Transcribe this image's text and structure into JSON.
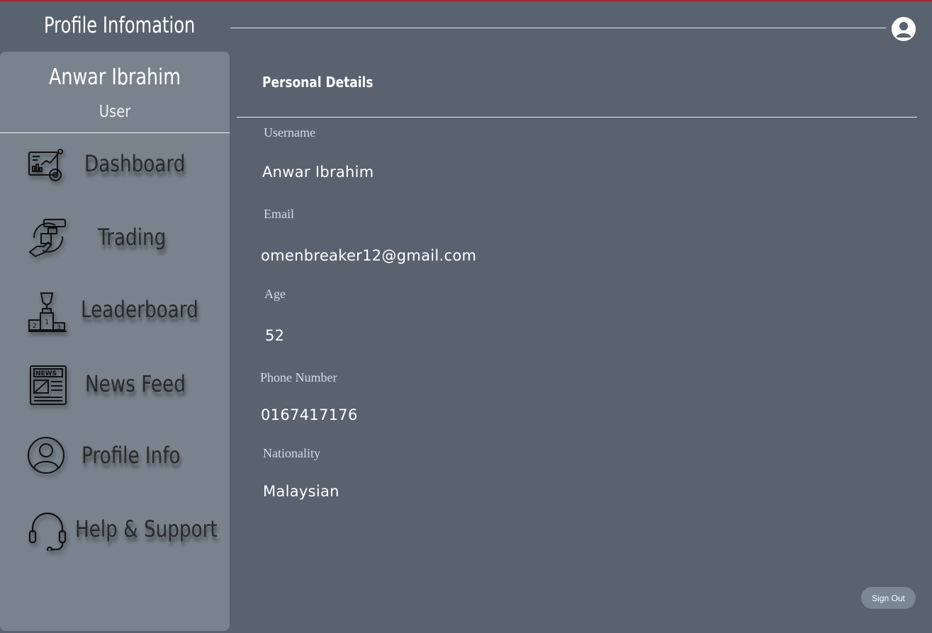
{
  "header": {
    "title": "Profile Infomation"
  },
  "sidebar": {
    "user_name": "Anwar Ibrahim",
    "user_role": "User",
    "items": [
      {
        "label": "Dashboard",
        "icon": "dashboard-icon"
      },
      {
        "label": "Trading",
        "icon": "trading-icon"
      },
      {
        "label": "Leaderboard",
        "icon": "podium-icon"
      },
      {
        "label": "News Feed",
        "icon": "newspaper-icon"
      },
      {
        "label": "Profile Info",
        "icon": "user-circle-icon"
      },
      {
        "label": "Help & Support",
        "icon": "headset-icon"
      }
    ]
  },
  "main": {
    "section_title": "Personal Details",
    "fields": [
      {
        "label": "Username",
        "value": "Anwar Ibrahim"
      },
      {
        "label": "Email",
        "value": "omenbreaker12@gmail.com"
      },
      {
        "label": "Age",
        "value": "52"
      },
      {
        "label": "Phone Number",
        "value": "0167417176"
      },
      {
        "label": "Nationality",
        "value": "Malaysian"
      }
    ],
    "signout_label": "Sign Out"
  },
  "colors": {
    "background": "#58636f",
    "sidebar": "#79838d",
    "accent_top": "#a3262d"
  }
}
